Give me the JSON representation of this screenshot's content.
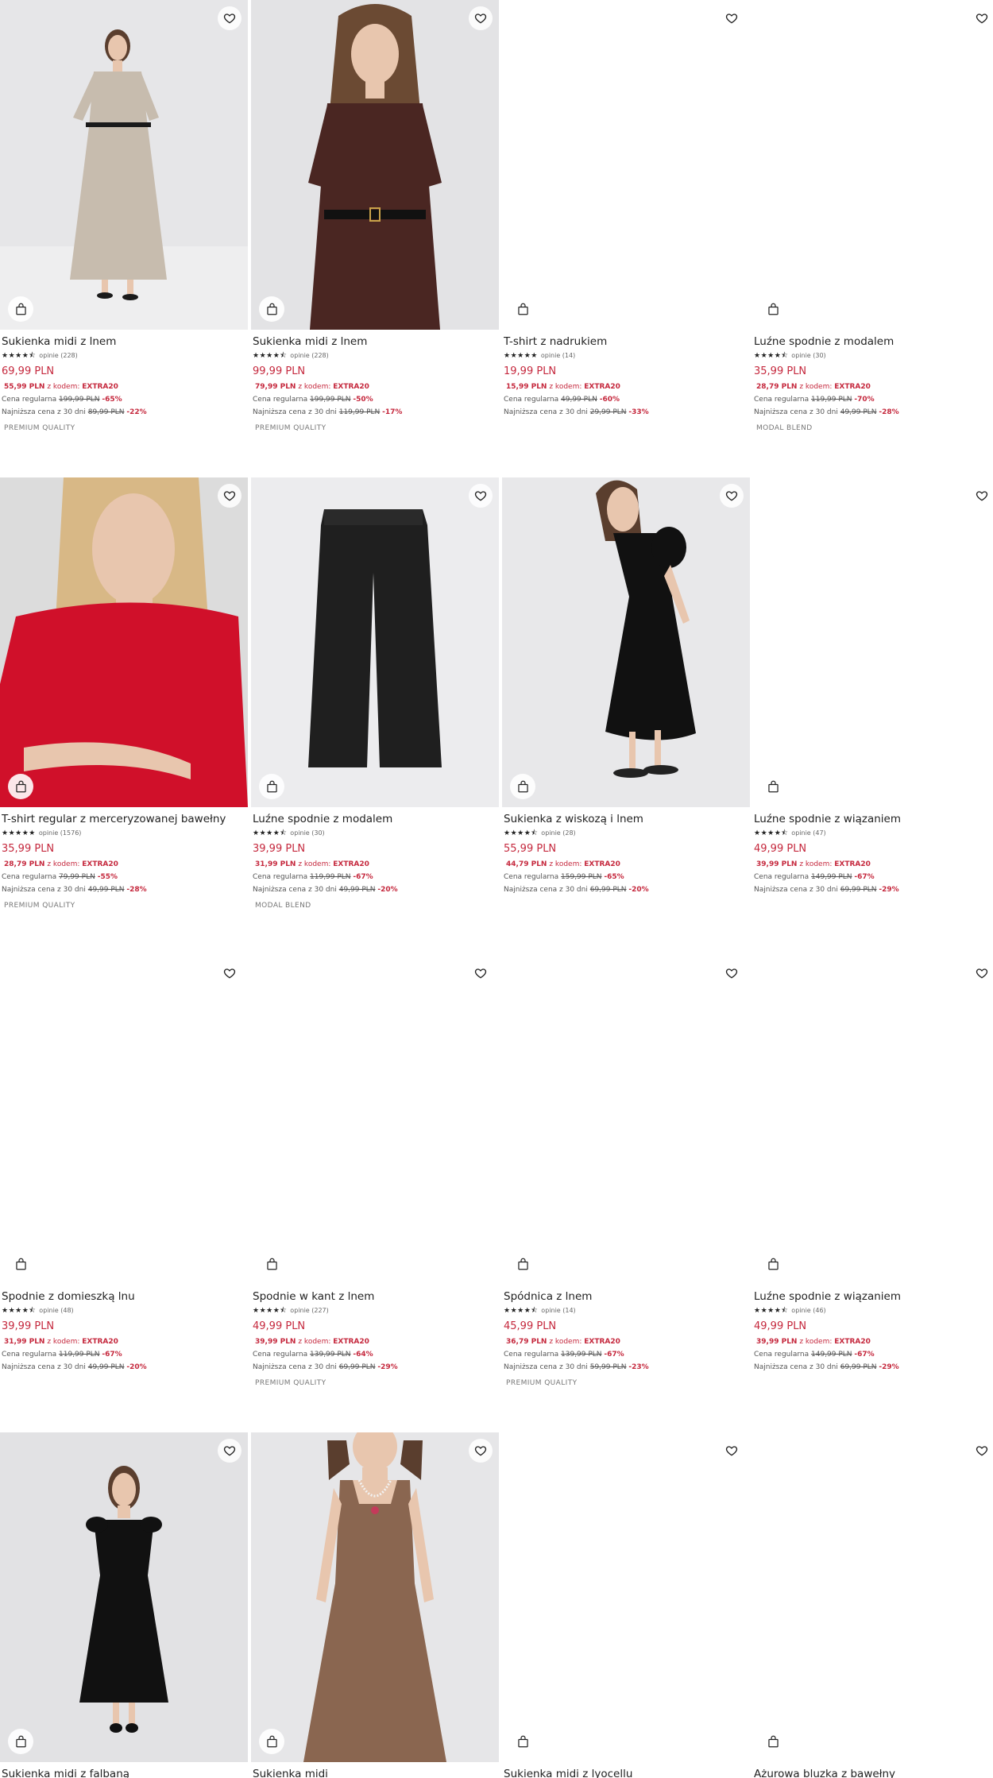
{
  "products": [
    {
      "name": "Sukienka midi z lnem",
      "stars": "★★★★⯪",
      "reviews": "opinie (228)",
      "price": "69,99 PLN",
      "code_price": "55,99 PLN",
      "code_text": "z kodem:",
      "code": "EXTRA20",
      "regular_label": "Cena regularna",
      "regular_price": "199,99 PLN",
      "regular_disc": "-65%",
      "lowest_label": "Najniższa cena z 30 dni",
      "lowest_price": "89,99 PLN",
      "lowest_disc": "-22%",
      "badge": "PREMIUM QUALITY",
      "image": "photo",
      "figure": "beige-dress"
    },
    {
      "name": "Sukienka midi z lnem",
      "stars": "★★★★⯪",
      "reviews": "opinie (228)",
      "price": "99,99 PLN",
      "code_price": "79,99 PLN",
      "code_text": "z kodem:",
      "code": "EXTRA20",
      "regular_label": "Cena regularna",
      "regular_price": "199,99 PLN",
      "regular_disc": "-50%",
      "lowest_label": "Najniższa cena z 30 dni",
      "lowest_price": "119,99 PLN",
      "lowest_disc": "-17%",
      "badge": "PREMIUM QUALITY",
      "image": "photo",
      "figure": "brown-dress"
    },
    {
      "name": "T-shirt z nadrukiem",
      "stars": "★★★★★",
      "reviews": "opinie (14)",
      "price": "19,99 PLN",
      "code_price": "15,99 PLN",
      "code_text": "z kodem:",
      "code": "EXTRA20",
      "regular_label": "Cena regularna",
      "regular_price": "49,99 PLN",
      "regular_disc": "-60%",
      "lowest_label": "Najniższa cena z 30 dni",
      "lowest_price": "29,99 PLN",
      "lowest_disc": "-33%",
      "badge": "",
      "image": "blank",
      "figure": ""
    },
    {
      "name": "Luźne spodnie z modalem",
      "stars": "★★★★⯪",
      "reviews": "opinie (30)",
      "price": "35,99 PLN",
      "code_price": "28,79 PLN",
      "code_text": "z kodem:",
      "code": "EXTRA20",
      "regular_label": "Cena regularna",
      "regular_price": "119,99 PLN",
      "regular_disc": "-70%",
      "lowest_label": "Najniższa cena z 30 dni",
      "lowest_price": "49,99 PLN",
      "lowest_disc": "-28%",
      "badge": "MODAL BLEND",
      "image": "blank",
      "figure": ""
    },
    {
      "name": "T-shirt regular z merceryzowanej bawełny",
      "stars": "★★★★★",
      "reviews": "opinie (1576)",
      "price": "35,99 PLN",
      "code_price": "28,79 PLN",
      "code_text": "z kodem:",
      "code": "EXTRA20",
      "regular_label": "Cena regularna",
      "regular_price": "79,99 PLN",
      "regular_disc": "-55%",
      "lowest_label": "Najniższa cena z 30 dni",
      "lowest_price": "49,99 PLN",
      "lowest_disc": "-28%",
      "badge": "PREMIUM QUALITY",
      "image": "photo",
      "figure": "red-tshirt"
    },
    {
      "name": "Luźne spodnie z modalem",
      "stars": "★★★★⯪",
      "reviews": "opinie (30)",
      "price": "39,99 PLN",
      "code_price": "31,99 PLN",
      "code_text": "z kodem:",
      "code": "EXTRA20",
      "regular_label": "Cena regularna",
      "regular_price": "119,99 PLN",
      "regular_disc": "-67%",
      "lowest_label": "Najniższa cena z 30 dni",
      "lowest_price": "49,99 PLN",
      "lowest_disc": "-20%",
      "badge": "MODAL BLEND",
      "image": "photo",
      "figure": "black-pants"
    },
    {
      "name": "Sukienka z wiskozą i lnem",
      "stars": "★★★★⯪",
      "reviews": "opinie (28)",
      "price": "55,99 PLN",
      "code_price": "44,79 PLN",
      "code_text": "z kodem:",
      "code": "EXTRA20",
      "regular_label": "Cena regularna",
      "regular_price": "159,99 PLN",
      "regular_disc": "-65%",
      "lowest_label": "Najniższa cena z 30 dni",
      "lowest_price": "69,99 PLN",
      "lowest_disc": "-20%",
      "badge": "",
      "image": "photo",
      "figure": "black-dress-side"
    },
    {
      "name": "Luźne spodnie z wiązaniem",
      "stars": "★★★★⯪",
      "reviews": "opinie (47)",
      "price": "49,99 PLN",
      "code_price": "39,99 PLN",
      "code_text": "z kodem:",
      "code": "EXTRA20",
      "regular_label": "Cena regularna",
      "regular_price": "149,99 PLN",
      "regular_disc": "-67%",
      "lowest_label": "Najniższa cena z 30 dni",
      "lowest_price": "69,99 PLN",
      "lowest_disc": "-29%",
      "badge": "",
      "image": "blank",
      "figure": ""
    },
    {
      "name": "Spodnie z domieszką lnu",
      "stars": "★★★★⯪",
      "reviews": "opinie (48)",
      "price": "39,99 PLN",
      "code_price": "31,99 PLN",
      "code_text": "z kodem:",
      "code": "EXTRA20",
      "regular_label": "Cena regularna",
      "regular_price": "119,99 PLN",
      "regular_disc": "-67%",
      "lowest_label": "Najniższa cena z 30 dni",
      "lowest_price": "49,99 PLN",
      "lowest_disc": "-20%",
      "badge": "",
      "image": "blank",
      "figure": ""
    },
    {
      "name": "Spodnie w kant z lnem",
      "stars": "★★★★⯪",
      "reviews": "opinie (227)",
      "price": "49,99 PLN",
      "code_price": "39,99 PLN",
      "code_text": "z kodem:",
      "code": "EXTRA20",
      "regular_label": "Cena regularna",
      "regular_price": "139,99 PLN",
      "regular_disc": "-64%",
      "lowest_label": "Najniższa cena z 30 dni",
      "lowest_price": "69,99 PLN",
      "lowest_disc": "-29%",
      "badge": "PREMIUM QUALITY",
      "image": "blank",
      "figure": ""
    },
    {
      "name": "Spódnica z lnem",
      "stars": "★★★★⯪",
      "reviews": "opinie (14)",
      "price": "45,99 PLN",
      "code_price": "36,79 PLN",
      "code_text": "z kodem:",
      "code": "EXTRA20",
      "regular_label": "Cena regularna",
      "regular_price": "139,99 PLN",
      "regular_disc": "-67%",
      "lowest_label": "Najniższa cena z 30 dni",
      "lowest_price": "59,99 PLN",
      "lowest_disc": "-23%",
      "badge": "PREMIUM QUALITY",
      "image": "blank",
      "figure": ""
    },
    {
      "name": "Luźne spodnie z wiązaniem",
      "stars": "★★★★⯪",
      "reviews": "opinie (46)",
      "price": "49,99 PLN",
      "code_price": "39,99 PLN",
      "code_text": "z kodem:",
      "code": "EXTRA20",
      "regular_label": "Cena regularna",
      "regular_price": "149,99 PLN",
      "regular_disc": "-67%",
      "lowest_label": "Najniższa cena z 30 dni",
      "lowest_price": "69,99 PLN",
      "lowest_disc": "-29%",
      "badge": "",
      "image": "blank",
      "figure": ""
    },
    {
      "name": "Sukienka midi z falbaną",
      "image": "photo",
      "figure": "black-dress-front"
    },
    {
      "name": "Sukienka midi",
      "image": "photo",
      "figure": "brown-tank-dress"
    },
    {
      "name": "Sukienka midi z lyocellu",
      "image": "blank",
      "figure": ""
    },
    {
      "name": "Ażurowa bluzka z bawełny",
      "image": "blank",
      "figure": ""
    }
  ],
  "icons": {
    "heart": "heart-icon",
    "bag": "shopping-bag-icon"
  },
  "colors": {
    "sale": "#c5283d"
  }
}
